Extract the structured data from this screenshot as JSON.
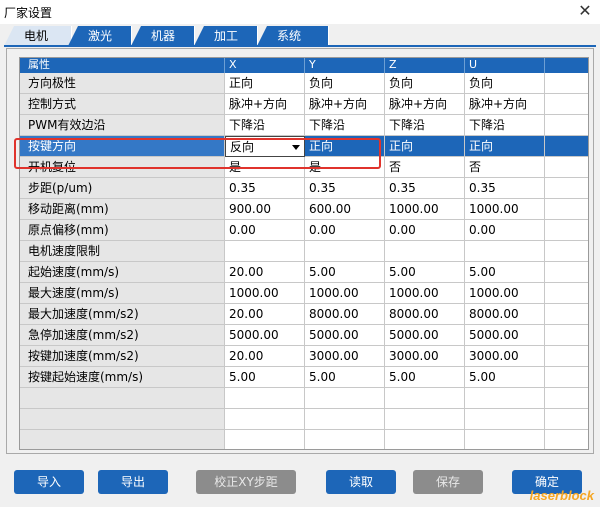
{
  "window": {
    "title": "厂家设置",
    "close_glyph": "✕"
  },
  "tabs": [
    "电机",
    "激光",
    "机器",
    "加工",
    "系统"
  ],
  "grid": {
    "columns": [
      "属性",
      "X",
      "Y",
      "Z",
      "U"
    ],
    "rows": [
      [
        "方向极性",
        "正向",
        "负向",
        "负向",
        "负向"
      ],
      [
        "控制方式",
        "脉冲+方向",
        "脉冲+方向",
        "脉冲+方向",
        "脉冲+方向"
      ],
      [
        "PWM有效边沿",
        "下降沿",
        "下降沿",
        "下降沿",
        "下降沿"
      ],
      [
        "按键方向",
        "反向",
        "正向",
        "正向",
        "正向"
      ],
      [
        "开机复位",
        "是",
        "是",
        "否",
        "否"
      ],
      [
        "步距(p/um)",
        "0.35",
        "0.35",
        "0.35",
        "0.35"
      ],
      [
        "移动距离(mm)",
        "900.00",
        "600.00",
        "1000.00",
        "1000.00"
      ],
      [
        "原点偏移(mm)",
        "0.00",
        "0.00",
        "0.00",
        "0.00"
      ],
      [
        "电机速度限制",
        "",
        "",
        "",
        ""
      ],
      [
        "起始速度(mm/s)",
        "20.00",
        "5.00",
        "5.00",
        "5.00"
      ],
      [
        "最大速度(mm/s)",
        "1000.00",
        "1000.00",
        "1000.00",
        "1000.00"
      ],
      [
        "最大加速度(mm/s2)",
        "20.00",
        "8000.00",
        "8000.00",
        "8000.00"
      ],
      [
        "急停加速度(mm/s2)",
        "5000.00",
        "5000.00",
        "5000.00",
        "5000.00"
      ],
      [
        "按键加速度(mm/s2)",
        "20.00",
        "3000.00",
        "3000.00",
        "3000.00"
      ],
      [
        "按键起始速度(mm/s)",
        "5.00",
        "5.00",
        "5.00",
        "5.00"
      ],
      [
        "",
        "",
        "",
        "",
        ""
      ],
      [
        "",
        "",
        "",
        "",
        ""
      ],
      [
        "",
        "",
        "",
        "",
        ""
      ]
    ],
    "selected_row": 3
  },
  "buttons": {
    "import": "导入",
    "export": "导出",
    "calibrate": "校正XY步距",
    "read": "读取",
    "save": "保存",
    "ok": "确定"
  },
  "watermark": "laserblock",
  "colors": {
    "accent": "#1d66b8",
    "highlight": "#e0332c"
  }
}
